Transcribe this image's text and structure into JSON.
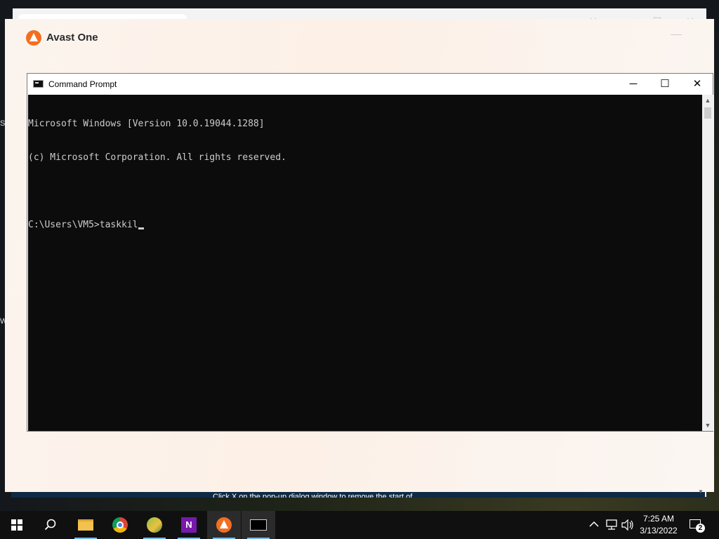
{
  "avast": {
    "title": "Avast One",
    "strip_text": "Click X on the pop-up dialog window to remove the start of",
    "left_edge_letters": [
      "S",
      "W"
    ]
  },
  "cmd": {
    "title": "Command Prompt",
    "lines": [
      "Microsoft Windows [Version 10.0.19044.1288]",
      "(c) Microsoft Corporation. All rights reserved.",
      "",
      "C:\\Users\\VM5>taskkil"
    ],
    "minimize": "─",
    "maximize": "☐",
    "close": "✕"
  },
  "taskbar": {
    "apps": [
      {
        "name": "start",
        "icon": "windows-logo-icon"
      },
      {
        "name": "search",
        "icon": "search-icon"
      },
      {
        "name": "file-explorer",
        "icon": "folder-icon"
      },
      {
        "name": "chrome",
        "icon": "chrome-icon"
      },
      {
        "name": "maps-app",
        "icon": "globe-icon"
      },
      {
        "name": "onenote",
        "icon": "onenote-icon",
        "label": "N"
      },
      {
        "name": "avast",
        "icon": "avast-icon"
      },
      {
        "name": "command-prompt",
        "icon": "cmd-icon"
      }
    ],
    "tray": {
      "chevron": "^",
      "time": "7:25 AM",
      "date": "3/13/2022",
      "notification_count": "2"
    }
  },
  "colors": {
    "console_bg": "#0c0c0c",
    "console_fg": "#cccccc",
    "avast_orange": "#f26f21",
    "taskbar_bg": "#101010"
  }
}
